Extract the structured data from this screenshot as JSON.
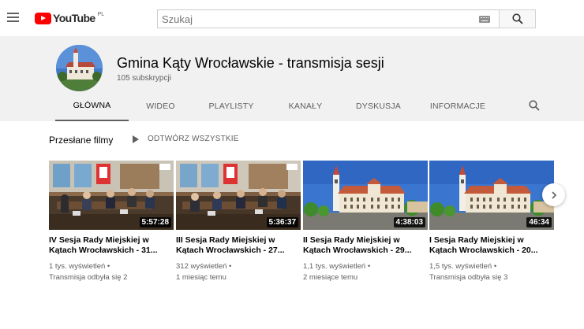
{
  "topbar": {
    "logo_text": "YouTube",
    "region": "PL",
    "search": {
      "placeholder": "Szukaj"
    }
  },
  "channel": {
    "name": "Gmina Kąty Wrocławskie - transmisja sesji",
    "subscribers": "105 subskrypcji",
    "tabs": [
      {
        "label": "GŁÓWNA",
        "active": true
      },
      {
        "label": "WIDEO"
      },
      {
        "label": "PLAYLISTY"
      },
      {
        "label": "KANAŁY"
      },
      {
        "label": "DYSKUSJA"
      },
      {
        "label": "INFORMACJE"
      }
    ]
  },
  "section": {
    "title": "Przesłane filmy",
    "play_all_label": "ODTWÓRZ WSZYSTKIE"
  },
  "videos": [
    {
      "title": "IV Sesja Rady Miejskiej w Kątach Wrocławskich - 31...",
      "duration": "5:57:28",
      "views": "1 tys. wyświetleń",
      "date": "Transmisja odbyła się 2",
      "thumb": "meeting"
    },
    {
      "title": "III Sesja Rady Miejskiej w Kątach Wrocławskich - 27...",
      "duration": "5:36:37",
      "views": "312 wyświetleń",
      "date": "1 miesiąc temu",
      "thumb": "meeting"
    },
    {
      "title": "II Sesja Rady Miejskiej w Kątach Wrocławskich - 29...",
      "duration": "4:38:03",
      "views": "1,1 tys. wyświetleń",
      "date": "2 miesiące temu",
      "thumb": "building"
    },
    {
      "title": "I Sesja Rady Miejskiej w Kątach Wrocławskich - 20...",
      "duration": "46:34",
      "views": "1,5 tys. wyświetleń",
      "date": "Transmisja odbyła się 3",
      "thumb": "building"
    }
  ],
  "colors": {
    "brand": "#ff0000",
    "header_bg": "#f1f1f1",
    "text_secondary": "#606060"
  }
}
